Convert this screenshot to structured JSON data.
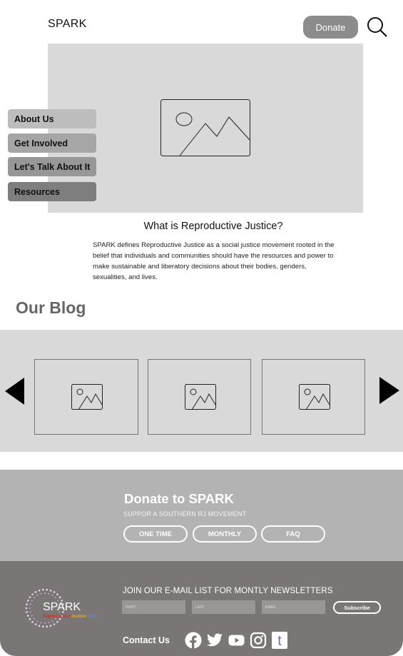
{
  "header": {
    "logo": "SPARK",
    "donate_label": "Donate"
  },
  "side_nav": {
    "items": [
      {
        "label": "About Us",
        "color": "#bdbdbd"
      },
      {
        "label": "Get Involved",
        "color": "#a6a6a6"
      },
      {
        "label": "Let's Talk About It",
        "color": "#979797"
      },
      {
        "label": "Resources",
        "color": "#7e7e7e"
      }
    ]
  },
  "intro": {
    "title": "What is Reproductive Justice?",
    "body": "SPARK defines Reproductive Justice as a social justice movement rooted in the belief that individuals and communities should have the resources and power to make sustainable and liberatory decisions about their bodies, genders, sexualities, and lives."
  },
  "blog": {
    "title": "Our Blog",
    "cards": [
      {
        "icon": "image-placeholder-icon"
      },
      {
        "icon": "image-placeholder-icon"
      },
      {
        "icon": "image-placeholder-icon"
      }
    ]
  },
  "donate": {
    "title": "Donate to SPARK",
    "subtitle": "SUPPOR A SOUTHERN RJ MOVEMENT",
    "buttons": [
      "ONE TIME",
      "MONTHLY",
      "FAQ"
    ]
  },
  "footer": {
    "logo_text": "SPARK",
    "logo_tagline_1": "Reproductive",
    "logo_tagline_2": "Justice",
    "logo_tagline_3": "Now",
    "newsletter_title": "JOIN OUR E-MAIL LIST FOR MONTLY NEWSLETTERS",
    "first_placeholder": "FIRST",
    "last_placeholder": "LAST",
    "email_placeholder": "EMAIL",
    "subscribe_label": "Subscribe",
    "contact_label": "Contact Us",
    "social": [
      "facebook-icon",
      "twitter-icon",
      "youtube-icon",
      "instagram-icon",
      "tumblr-icon"
    ],
    "tumblr_color": "#8a5fb0"
  }
}
